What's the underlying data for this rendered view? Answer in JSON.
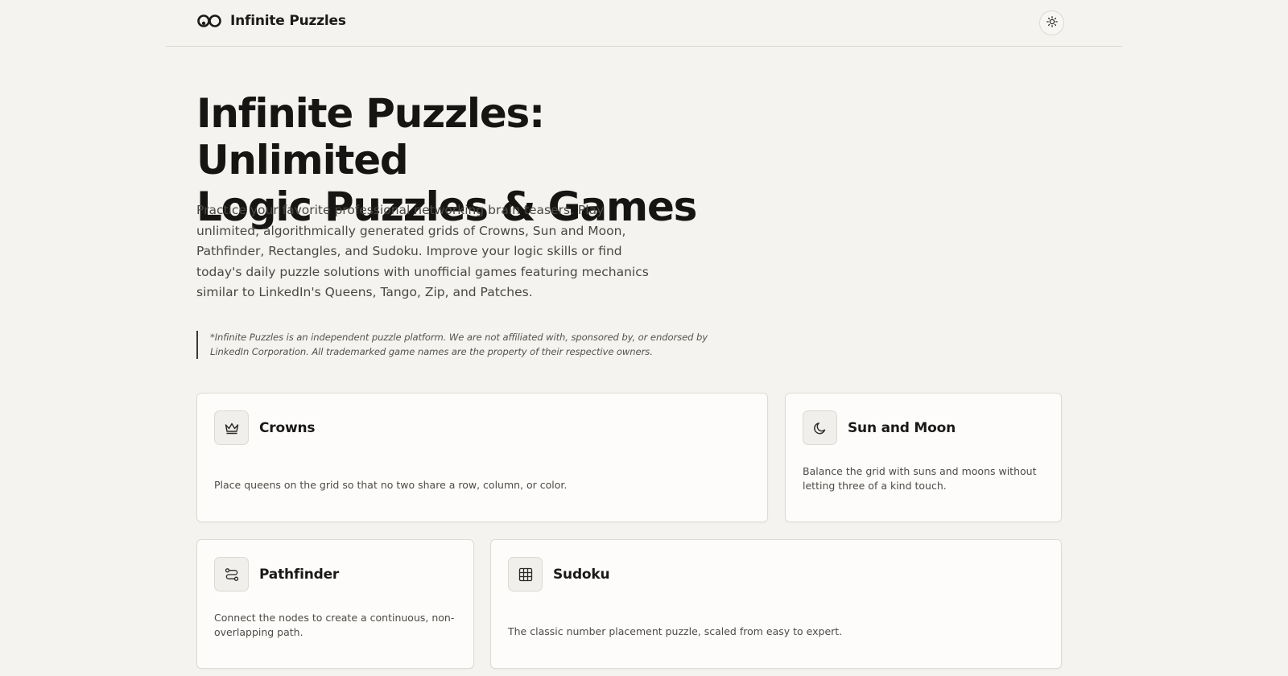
{
  "header": {
    "brand_name": "Infinite Puzzles",
    "logo_icon": "infinity-knot-icon",
    "theme_toggle_icon": "sun-icon"
  },
  "hero": {
    "title_line1": "Infinite Puzzles: Unlimited",
    "title_line2": "Logic Puzzles & Games",
    "description": "Practice your favorite professional networking brain teasers. Play unlimited, algorithmically generated grids of Crowns, Sun and Moon, Pathfinder, Rectangles, and Sudoku. Improve your logic skills or find today's daily puzzle solutions with unofficial games featuring mechanics similar to LinkedIn's Queens, Tango, Zip, and Patches.",
    "disclaimer": "*Infinite Puzzles is an independent puzzle platform. We are not affiliated with, sponsored by, or endorsed by LinkedIn Corporation. All trademarked game names are the property of their respective owners."
  },
  "games": [
    {
      "title": "Crowns",
      "icon": "crown-icon",
      "description": "Place queens on the grid so that no two share a row, column, or color."
    },
    {
      "title": "Sun and Moon",
      "icon": "moon-icon",
      "description": "Balance the grid with suns and moons without letting three of a kind touch."
    },
    {
      "title": "Pathfinder",
      "icon": "route-icon",
      "description": "Connect the nodes to create a continuous, non-overlapping path."
    },
    {
      "title": "Sudoku",
      "icon": "grid-icon",
      "description": "The classic number placement puzzle, scaled from easy to expert."
    }
  ],
  "colors": {
    "background": "#f5f3ef",
    "card_background": "#fdfcfa",
    "text_primary": "#161513",
    "text_secondary": "#4a4843"
  }
}
